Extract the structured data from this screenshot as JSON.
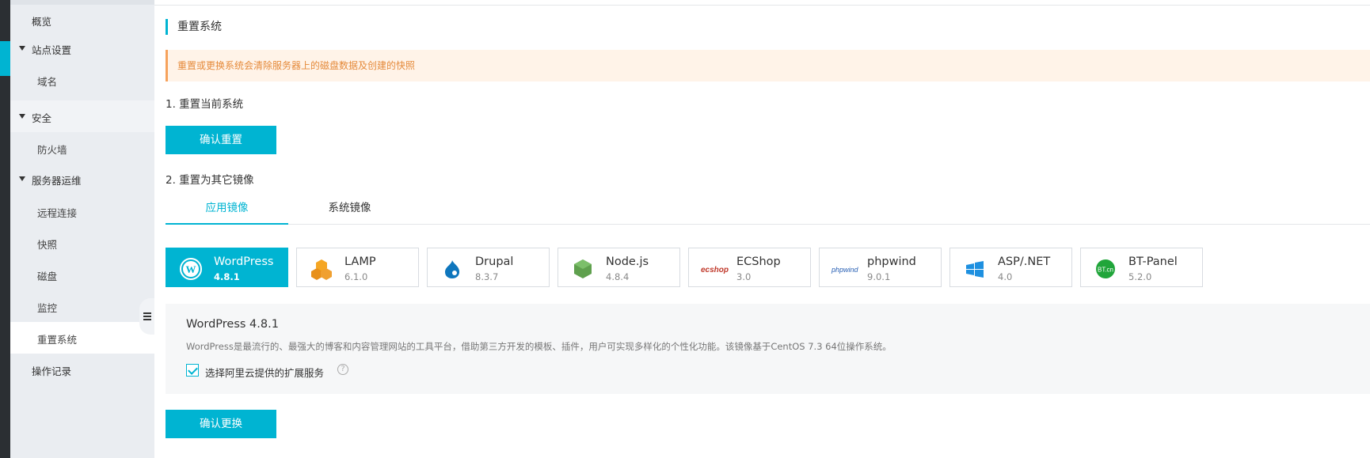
{
  "sidebar": {
    "overview": "概览",
    "site_settings": "站点设置",
    "domain": "域名",
    "security": "安全",
    "firewall": "防火墙",
    "server_ops": "服务器运维",
    "remote_connect": "远程连接",
    "snapshot": "快照",
    "disk": "磁盘",
    "monitor": "监控",
    "reset_system": "重置系统",
    "operation_log": "操作记录"
  },
  "main": {
    "section_title": "重置系统",
    "warning": "重置或更换系统会清除服务器上的磁盘数据及创建的快照",
    "step1": "1. 重置当前系统",
    "confirm_reset_label": "确认重置",
    "step2": "2. 重置为其它镜像",
    "tabs": [
      {
        "label": "应用镜像",
        "active": true
      },
      {
        "label": "系统镜像",
        "active": false
      }
    ],
    "images": [
      {
        "name": "WordPress",
        "version": "4.8.1",
        "icon": "wordpress-icon",
        "selected": true
      },
      {
        "name": "LAMP",
        "version": "6.1.0",
        "icon": "lamp-icon",
        "selected": false
      },
      {
        "name": "Drupal",
        "version": "8.3.7",
        "icon": "drupal-icon",
        "selected": false
      },
      {
        "name": "Node.js",
        "version": "4.8.4",
        "icon": "nodejs-icon",
        "selected": false
      },
      {
        "name": "ECShop",
        "version": "3.0",
        "icon": "ecshop-icon",
        "selected": false
      },
      {
        "name": "phpwind",
        "version": "9.0.1",
        "icon": "phpwind-icon",
        "selected": false
      },
      {
        "name": "ASP/.NET",
        "version": "4.0",
        "icon": "aspnet-icon",
        "selected": false
      },
      {
        "name": "BT-Panel",
        "version": "5.2.0",
        "icon": "btpanel-icon",
        "selected": false
      }
    ],
    "detail": {
      "title": "WordPress 4.8.1",
      "description": "WordPress是最流行的、最强大的博客和内容管理网站的工具平台，借助第三方开发的模板、插件，用户可实现多样化的个性化功能。该镜像基于CentOS 7.3 64位操作系统。",
      "checkbox_label": "选择阿里云提供的扩展服务",
      "checkbox_checked": true,
      "help_glyph": "?"
    },
    "confirm_change_label": "确认更换"
  },
  "icon_glyphs": {
    "ecshop": "ecshop",
    "phpwind": "phpwind",
    "btpanel": "BT.cn"
  },
  "colors": {
    "accent": "#00b4d2",
    "warning_bg": "#fff3e8",
    "warning_text": "#e58a3a",
    "sidebar_bg": "#eaedf1"
  }
}
